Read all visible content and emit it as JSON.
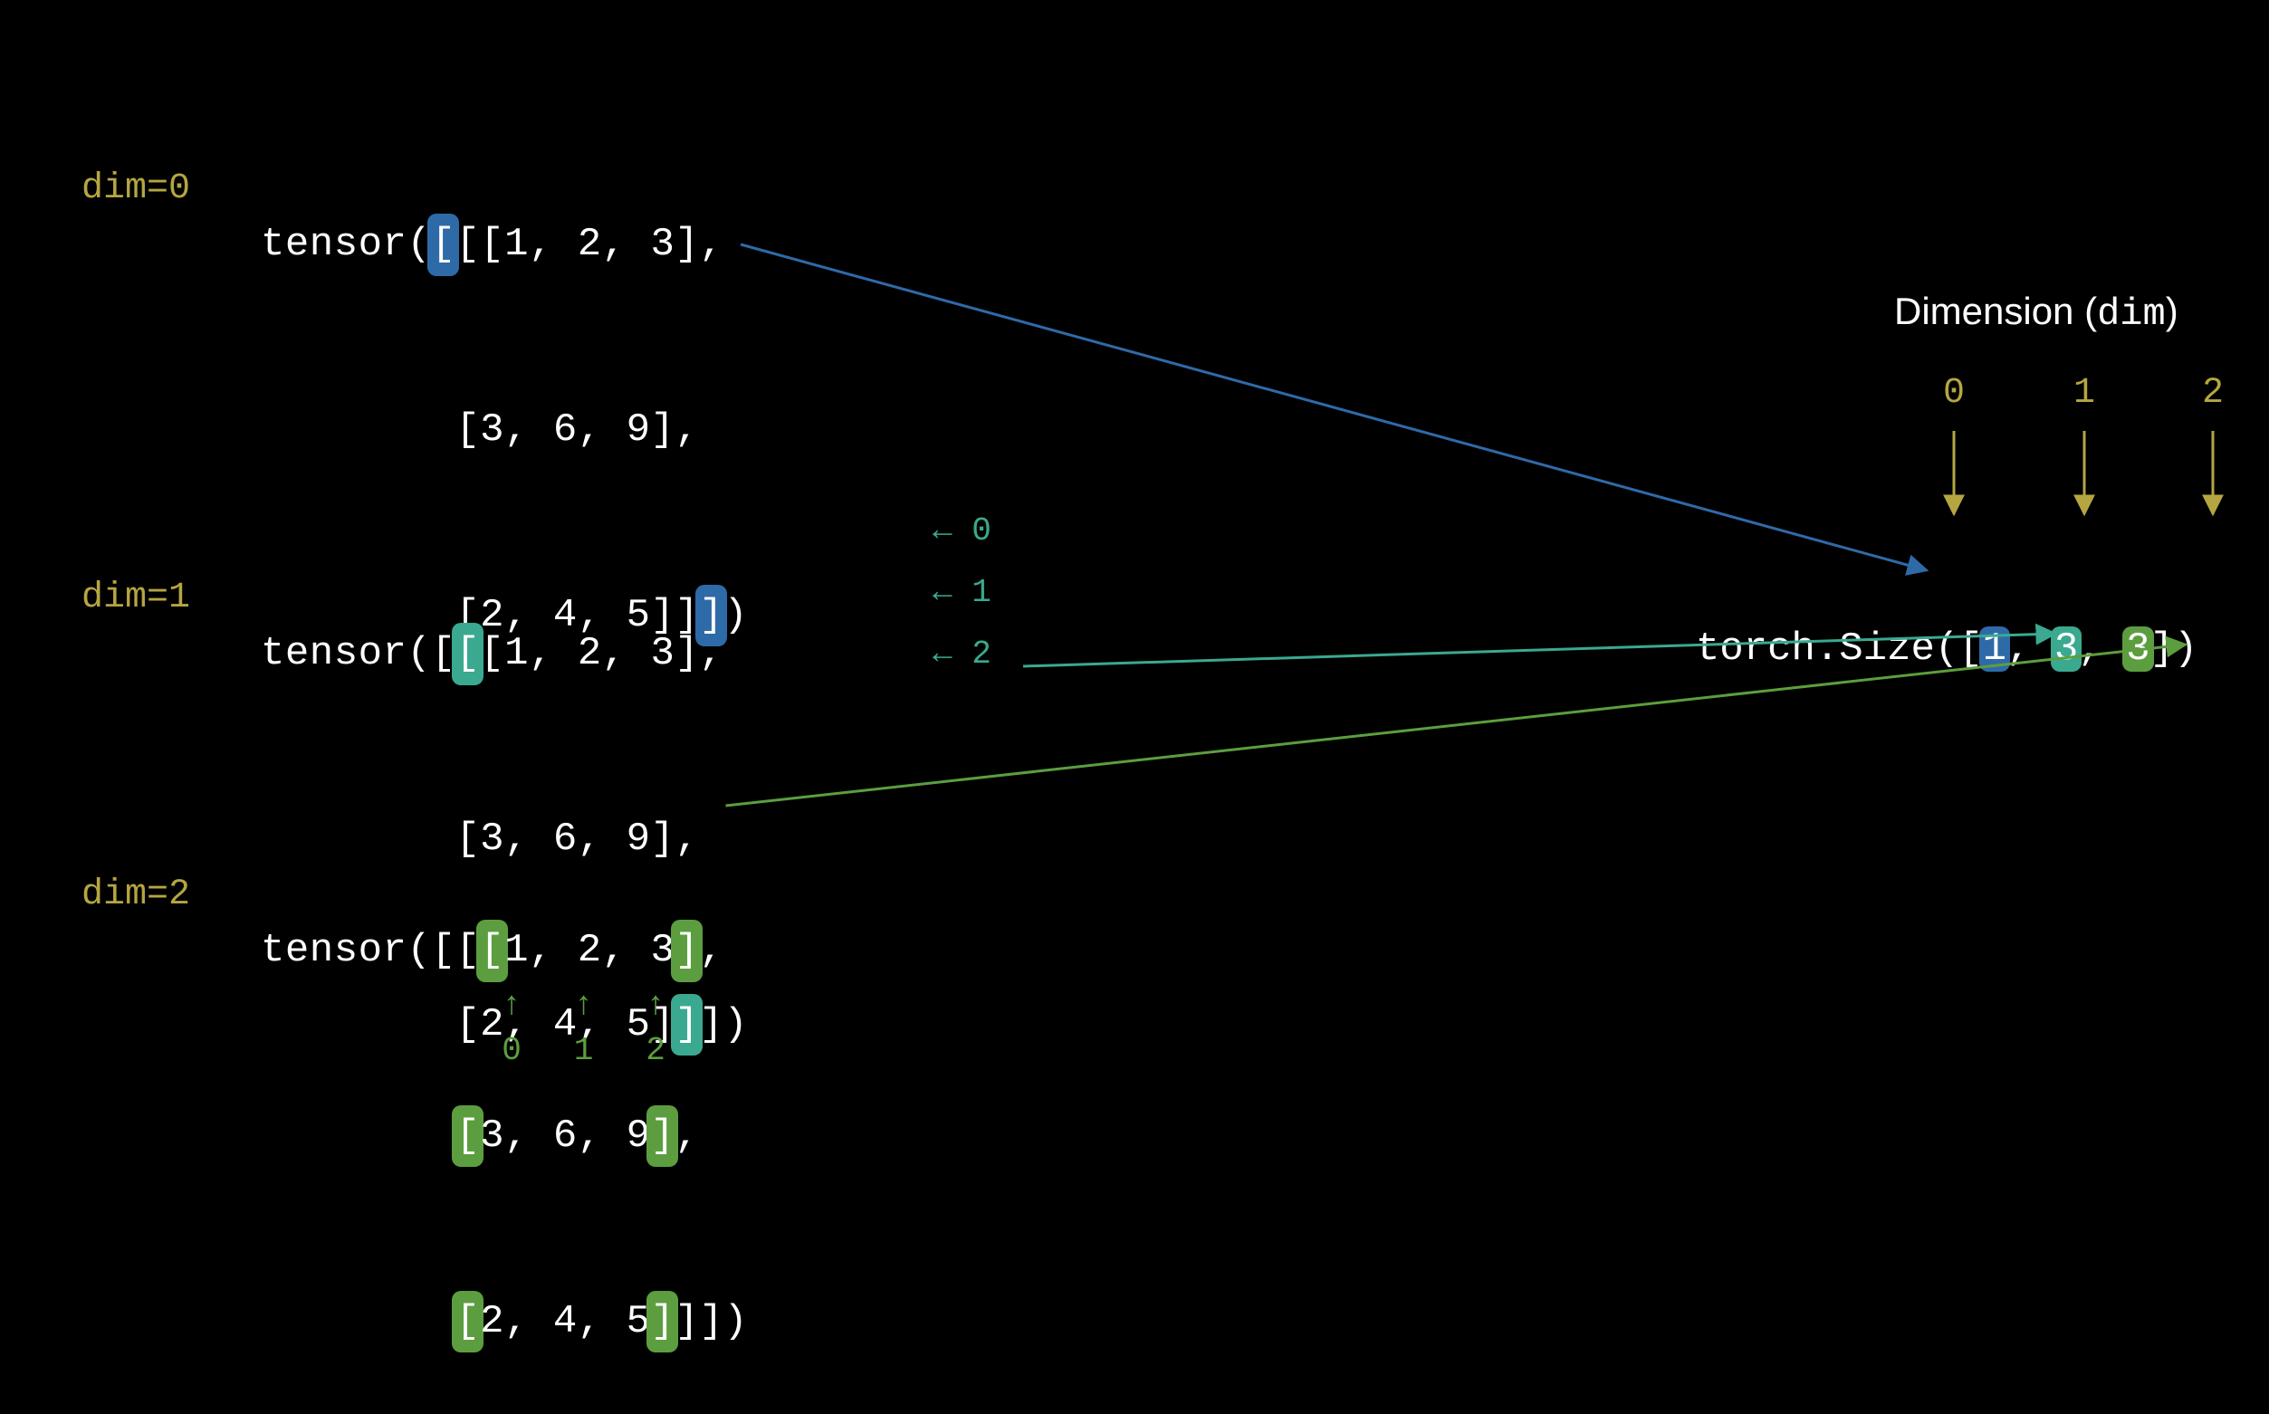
{
  "colors": {
    "blue": "#2f6aa8",
    "teal": "#3aa98f",
    "green": "#5c9e3f",
    "olive": "#b5a642"
  },
  "dim_labels": {
    "dim0": "dim=0",
    "dim1": "dim=1",
    "dim2": "dim=2"
  },
  "tensor": {
    "prefix": "tensor(",
    "row1_open": "[[[",
    "row_values": {
      "r1": "1, 2, 3",
      "r2": "3, 6, 9",
      "r3": "2, 4, 5"
    },
    "row1_close": "],",
    "row2_open": "[",
    "row2_close": "],",
    "row3_open": "[",
    "row3_close": "]]])"
  },
  "row_annotations": {
    "arrow": "←",
    "i0": "0",
    "i1": "1",
    "i2": "2"
  },
  "col_annotations": {
    "arrow": "↑",
    "c0": "0",
    "c1": "1",
    "c2": "2"
  },
  "right": {
    "title_plain": "Dimension (",
    "title_mono": "dim",
    "title_close": ")",
    "indices": {
      "i0": "0",
      "i1": "1",
      "i2": "2"
    },
    "size_prefix": "torch.Size([",
    "size_values": {
      "v0": "1",
      "v1": "3",
      "v2": "3"
    },
    "size_suffix": "])",
    "comma": ", "
  }
}
